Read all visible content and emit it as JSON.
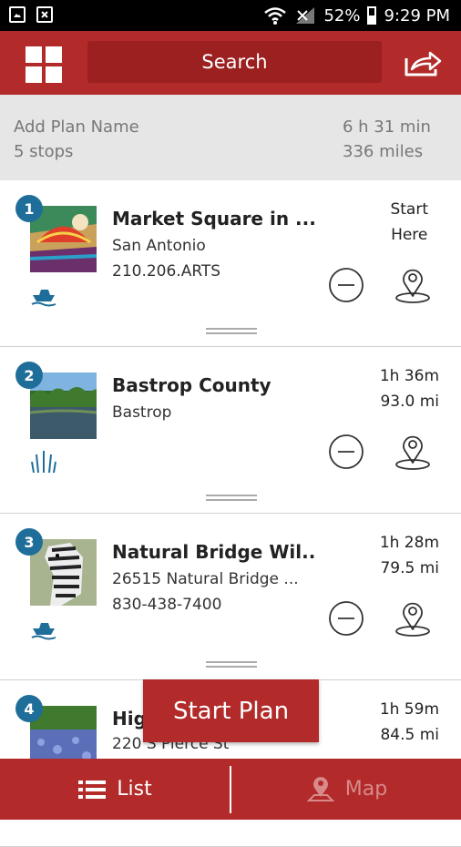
{
  "status_bar": {
    "battery": "52%",
    "time": "9:29 PM"
  },
  "app_bar": {
    "search_label": "Search"
  },
  "summary": {
    "plan_name_placeholder": "Add Plan Name",
    "stops": "5 stops",
    "duration": "6 h 31 min",
    "distance": "336 miles"
  },
  "stops": [
    {
      "number": "1",
      "title": "Market Square in ...",
      "line2": "San Antonio",
      "line3": "210.206.ARTS",
      "time": "Start",
      "dist": "Here",
      "category_icon": "boat-icon"
    },
    {
      "number": "2",
      "title": "Bastrop County",
      "line2": "Bastrop",
      "line3": "",
      "time": "1h 36m",
      "dist": "93.0 mi",
      "category_icon": "reeds-icon"
    },
    {
      "number": "3",
      "title": "Natural Bridge Wil..",
      "line2": "26515 Natural Bridge ...",
      "line3": "830-438-7400",
      "time": "1h 28m",
      "dist": "79.5 mi",
      "category_icon": "boat-icon"
    },
    {
      "number": "4",
      "title": "Hig",
      "line2": "220 S Pierce St",
      "line3": "",
      "time": "1h 59m",
      "dist": "84.5 mi",
      "category_icon": ""
    }
  ],
  "start_plan_label": "Start Plan",
  "tabs": {
    "list": "List",
    "map": "Map"
  },
  "colors": {
    "primary": "#b22a2a",
    "badge": "#1f6e9a"
  }
}
